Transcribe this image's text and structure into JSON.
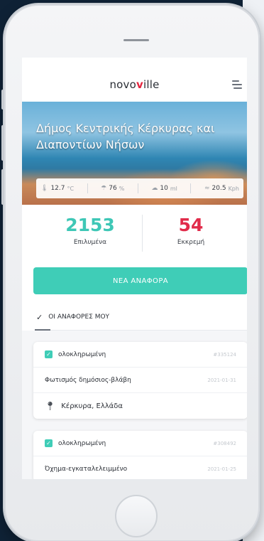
{
  "app": {
    "logo_prefix": "novo",
    "logo_v": "v",
    "logo_suffix": "ille"
  },
  "hero": {
    "title": "Δήμος Κεντρικής Κέρκυρας και Διαποντίων Νήσων"
  },
  "weather": [
    {
      "icon": "thermometer-icon",
      "value": "12.7",
      "unit": "°C"
    },
    {
      "icon": "humidity-icon",
      "value": "76",
      "unit": "%"
    },
    {
      "icon": "rain-icon",
      "value": "10",
      "unit": "ml"
    },
    {
      "icon": "wind-icon",
      "value": "20.5",
      "unit": "Kph"
    }
  ],
  "stats": {
    "solved_count": "2153",
    "solved_label": "Επιλυμένα",
    "pending_count": "54",
    "pending_label": "Εκκρεμή"
  },
  "new_report_label": "ΝΕΑ ΑΝΑΦΟΡΑ",
  "my_reports_tab": "ΟΙ ΑΝΑΦΟΡΕΣ ΜΟΥ",
  "reports": [
    {
      "status": "ολοκληρωμένη",
      "id": "#335124",
      "title": "Φωτισμός δημόσιος-βλάβη",
      "date": "2021-01-31",
      "location": "Κέρκυρα, Ελλάδα"
    },
    {
      "status": "ολοκληρωμένη",
      "id": "#308492",
      "title": "Όχημα-εγκαταλελειμμένο",
      "date": "2021-01-25"
    }
  ],
  "colors": {
    "accent": "#3fcdb7",
    "pending": "#e12b4a",
    "background": "#0f2236"
  }
}
